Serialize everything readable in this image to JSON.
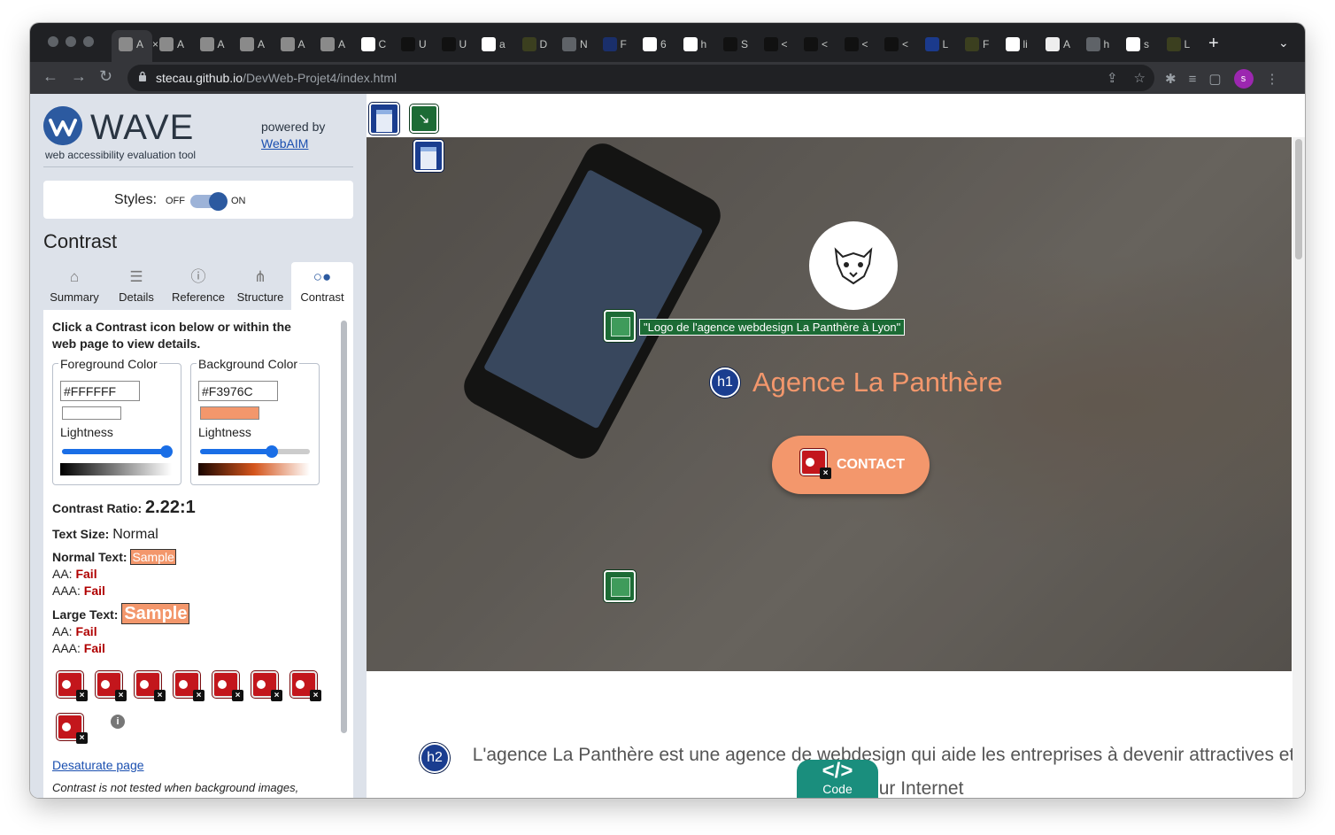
{
  "browser": {
    "tabs": [
      {
        "label": "A",
        "icon": "wave-favicon"
      },
      {
        "label": "A",
        "icon": "wave-favicon"
      },
      {
        "label": "A",
        "icon": "wave-favicon"
      },
      {
        "label": "A",
        "icon": "wave-favicon"
      },
      {
        "label": "A",
        "icon": "wave-favicon"
      },
      {
        "label": "A",
        "icon": "wave-favicon"
      },
      {
        "label": "C",
        "icon": "colorful-favicon"
      },
      {
        "label": "U",
        "icon": "mdn-favicon"
      },
      {
        "label": "U",
        "icon": "mdn-favicon"
      },
      {
        "label": "a",
        "icon": "google-favicon"
      },
      {
        "label": "D",
        "icon": "panther-favicon"
      },
      {
        "label": "N",
        "icon": "globe-favicon"
      },
      {
        "label": "F",
        "icon": "blue-favicon"
      },
      {
        "label": "6",
        "icon": "figma-favicon"
      },
      {
        "label": "h",
        "icon": "google-favicon"
      },
      {
        "label": "S",
        "icon": "mdn-favicon"
      },
      {
        "label": "<",
        "icon": "mdn-favicon"
      },
      {
        "label": "<",
        "icon": "mdn-favicon"
      },
      {
        "label": "<",
        "icon": "mdn-favicon"
      },
      {
        "label": "<",
        "icon": "mdn-favicon"
      },
      {
        "label": "L",
        "icon": "w3-favicon"
      },
      {
        "label": "F",
        "icon": "panther-favicon"
      },
      {
        "label": "li",
        "icon": "google-favicon"
      },
      {
        "label": "A",
        "icon": "doc-favicon"
      },
      {
        "label": "h",
        "icon": "globe-favicon"
      },
      {
        "label": "s",
        "icon": "google-favicon"
      },
      {
        "label": "L",
        "icon": "panther-favicon"
      }
    ],
    "active_tab_label": "A",
    "url_host": "stecau.github.io",
    "url_path": "/DevWeb-Projet4/index.html",
    "profile_initial": "s"
  },
  "wave": {
    "title": "WAVE",
    "subtitle": "web accessibility evaluation tool",
    "powered_by": "powered by",
    "webaim_link": "WebAIM",
    "styles_label": "Styles:",
    "styles_off": "OFF",
    "styles_on": "ON",
    "section_title": "Contrast",
    "tabs": [
      {
        "label": "Summary",
        "icon": "home-icon"
      },
      {
        "label": "Details",
        "icon": "list-icon"
      },
      {
        "label": "Reference",
        "icon": "info-icon"
      },
      {
        "label": "Structure",
        "icon": "sitemap-icon"
      },
      {
        "label": "Contrast",
        "icon": "contrast-icon"
      }
    ],
    "instructions": "Click a Contrast icon below or within the web page to view details.",
    "foreground": {
      "legend": "Foreground Color",
      "hex": "#FFFFFF",
      "lightness_label": "Lightness",
      "lightness": 0.95,
      "color": "#FFFFFF"
    },
    "background": {
      "legend": "Background Color",
      "hex": "#F3976C",
      "lightness_label": "Lightness",
      "lightness": 0.65,
      "color": "#F3976C"
    },
    "contrast_ratio_label": "Contrast Ratio:",
    "contrast_ratio": "2.22:1",
    "text_size_label": "Text Size:",
    "text_size": "Normal",
    "normal_text_label": "Normal Text:",
    "large_text_label": "Large Text:",
    "sample": "Sample",
    "aa_label": "AA:",
    "aaa_label": "AAA:",
    "fail": "Fail",
    "error_count": 8,
    "desaturate_link": "Desaturate page",
    "note": "Contrast is not tested when background images,"
  },
  "page": {
    "logo_alt": "\"Logo de l'agence webdesign La Panthère à Lyon\"",
    "h1_badge": "h1",
    "h1_text": "Agence La Panthère",
    "contact_button": "CONTACT",
    "h2_badge": "h2",
    "intro_text": "L'agence La Panthère est une agence de webdesign qui aide les entreprises à devenir attractives et visibles sur Internet",
    "code_symbol": "</>",
    "code_label": "Code"
  },
  "colors": {
    "accent": "#F3976C",
    "wave_blue": "#2C5AA0",
    "error_red": "#C3161C",
    "alert_green": "#1C6B35",
    "code_teal": "#1A8E7D"
  }
}
